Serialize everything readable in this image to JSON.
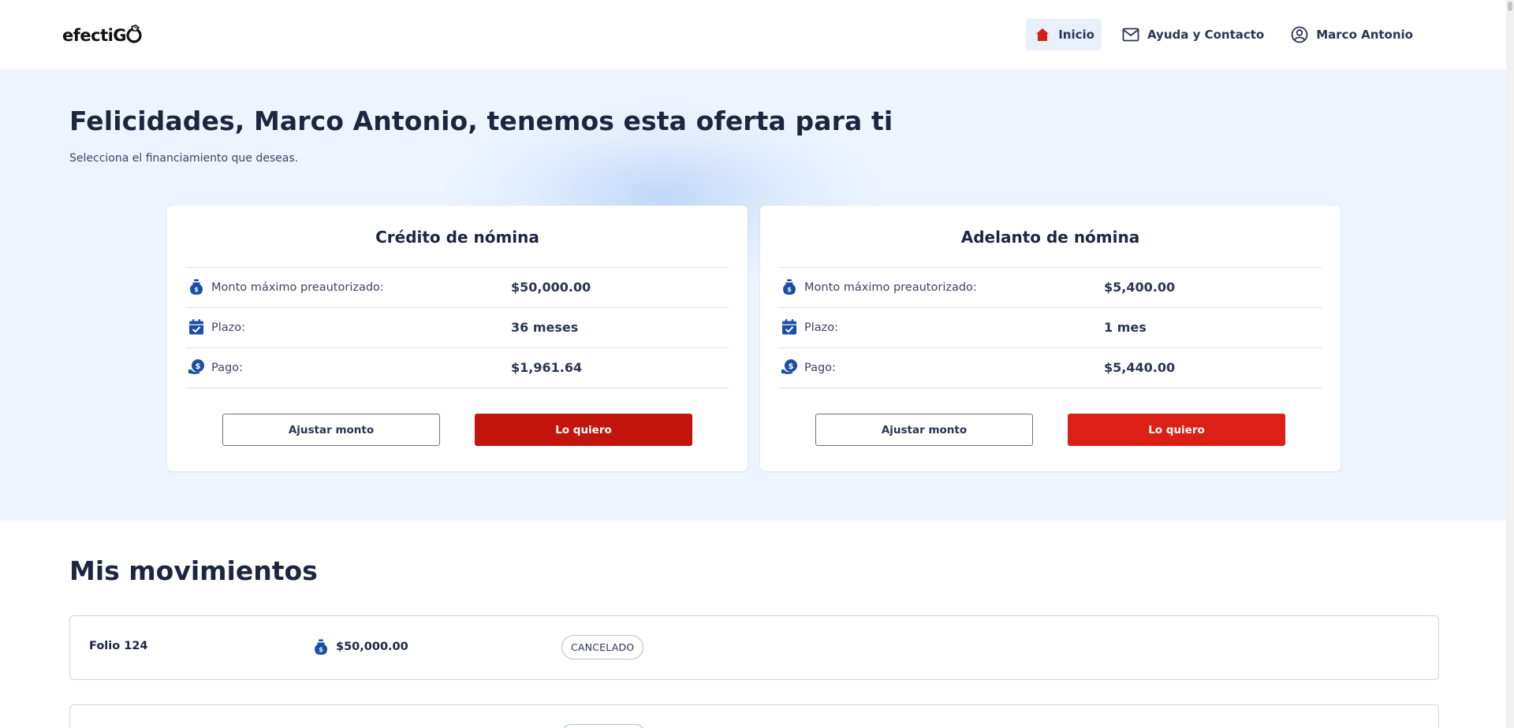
{
  "header": {
    "logo": "efectiGO",
    "nav": [
      {
        "label": "Inicio",
        "icon": "home-icon",
        "active": true
      },
      {
        "label": "Ayuda y Contacto",
        "icon": "mail-icon"
      },
      {
        "label": "Marco Antonio",
        "icon": "user-circle-icon"
      }
    ]
  },
  "hero": {
    "title": "Felicidades, Marco Antonio, tenemos esta oferta para ti",
    "subtitle": "Selecciona el financiamiento que deseas."
  },
  "offers": [
    {
      "title": "Crédito de nómina",
      "rows": [
        {
          "icon": "money-bag-icon",
          "label": "Monto máximo preautorizado:",
          "value": "$50,000.00"
        },
        {
          "icon": "calendar-check-icon",
          "label": "Plazo:",
          "value": "36 meses"
        },
        {
          "icon": "payment-hand-icon",
          "label": "Pago:",
          "value": "$1,961.64"
        }
      ],
      "adjust_label": "Ajustar monto",
      "want_label": "Lo quiero"
    },
    {
      "title": "Adelanto de nómina",
      "rows": [
        {
          "icon": "money-bag-icon",
          "label": "Monto máximo preautorizado:",
          "value": "$5,400.00"
        },
        {
          "icon": "calendar-check-icon",
          "label": "Plazo:",
          "value": "1 mes"
        },
        {
          "icon": "payment-hand-icon",
          "label": "Pago:",
          "value": "$5,440.00"
        }
      ],
      "adjust_label": "Ajustar monto",
      "want_label": "Lo quiero"
    }
  ],
  "movements": {
    "title": "Mis movimientos",
    "items": [
      {
        "folio": "Folio 124",
        "amount": "$50,000.00",
        "status": "CANCELADO"
      }
    ]
  },
  "colors": {
    "brand_red": "#c3150b",
    "brand_red_alt": "#dc2016",
    "icon_blue": "#1a4fa8",
    "hero_bg": "#edf4fe"
  }
}
